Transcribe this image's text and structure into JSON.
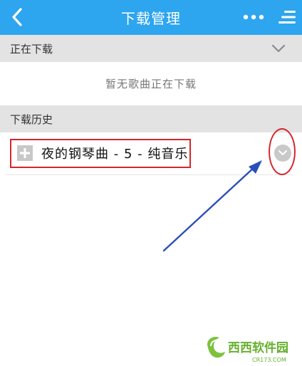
{
  "header": {
    "title": "下载管理",
    "back_icon": "chevron-left-icon",
    "more_icon": "more-dots-icon",
    "menu_icon": "list-menu-icon",
    "background_color": "#2ea5ef"
  },
  "downloading_section": {
    "label": "正在下载",
    "empty_message": "暂无歌曲正在下载",
    "chevron_icon": "chevron-down-icon"
  },
  "history_section": {
    "label": "下载历史",
    "items": [
      {
        "title": "夜的钢琴曲 - 5 - 纯音乐",
        "add_icon": "plus-icon",
        "expand_icon": "chevron-down-circle-icon"
      }
    ]
  },
  "annotations": {
    "highlight_color": "#d6262b",
    "arrow_color": "#2b4fb8"
  },
  "watermark": {
    "brand": "西西软件园",
    "url": "CR173.COM"
  }
}
